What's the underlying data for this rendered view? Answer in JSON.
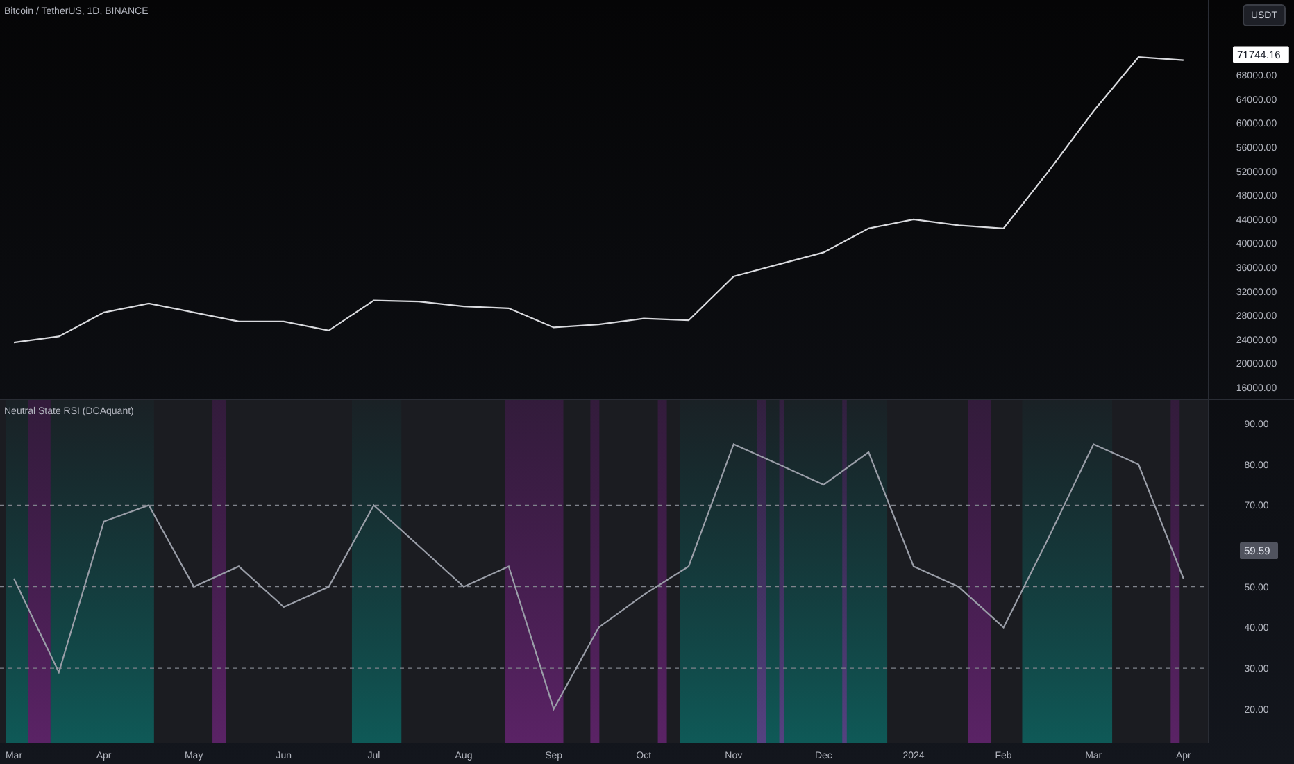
{
  "header": {
    "symbol_title": "Bitcoin / TetherUS, 1D, BINANCE",
    "currency_button": "USDT"
  },
  "price_chart": {
    "last_price_badge": "71744.16",
    "chart_data": {
      "type": "line",
      "categories": [
        null,
        null,
        null,
        null,
        null,
        null,
        null,
        null,
        null,
        null,
        null,
        null,
        null,
        null,
        null,
        null,
        null,
        null,
        null,
        null,
        null,
        null,
        null,
        null,
        null,
        null,
        null
      ],
      "series": [
        {
          "color": "#d9dade",
          "values": [
            23500,
            24500,
            28500,
            30000,
            28500,
            27000,
            27000,
            25500,
            30500,
            30300,
            29500,
            29200,
            26000,
            26500,
            27500,
            27200,
            34500,
            36500,
            38500,
            42500,
            44000,
            43000,
            42500,
            52000,
            62000,
            71000,
            70500
          ]
        }
      ],
      "ylim": [
        14150,
        80500
      ],
      "yticks": [
        {
          "value": 68000,
          "label": "68000.00"
        },
        {
          "value": 64000,
          "label": "64000.00"
        },
        {
          "value": 60000,
          "label": "60000.00"
        },
        {
          "value": 56000,
          "label": "56000.00"
        },
        {
          "value": 52000,
          "label": "52000.00"
        },
        {
          "value": 48000,
          "label": "48000.00"
        },
        {
          "value": 44000,
          "label": "44000.00"
        },
        {
          "value": 40000,
          "label": "40000.00"
        },
        {
          "value": 36000,
          "label": "36000.00"
        },
        {
          "value": 32000,
          "label": "32000.00"
        },
        {
          "value": 28000,
          "label": "28000.00"
        },
        {
          "value": 24000,
          "label": "24000.00"
        },
        {
          "value": 20000,
          "label": "20000.00"
        },
        {
          "value": 16000,
          "label": "16000.00"
        }
      ]
    }
  },
  "indicator": {
    "title": "Neutral State RSI (DCAquant)",
    "last_value_badge": "59.59",
    "chart_data": {
      "type": "line",
      "categories": [
        "Mar",
        null,
        "Apr",
        null,
        "May",
        null,
        "Jun",
        null,
        "Jul",
        null,
        "Aug",
        null,
        "Sep",
        null,
        "Oct",
        null,
        "Nov",
        null,
        "Dec",
        null,
        "2024",
        null,
        "Feb",
        null,
        "Mar",
        null,
        "Apr"
      ],
      "series": [
        {
          "color": "#9a9ea8",
          "values": [
            52,
            29,
            66,
            70,
            50,
            55,
            45,
            50,
            70,
            60,
            50,
            55,
            20,
            40,
            48,
            55,
            85,
            80,
            75,
            83,
            55,
            50,
            40,
            62,
            85,
            80,
            52
          ]
        }
      ],
      "ylim": [
        11.6,
        95.8
      ],
      "yticks": [
        {
          "value": 90,
          "label": "90.00"
        },
        {
          "value": 80,
          "label": "80.00"
        },
        {
          "value": 70,
          "label": "70.00"
        },
        {
          "value": 50,
          "label": "50.00"
        },
        {
          "value": 40,
          "label": "40.00"
        },
        {
          "value": 30,
          "label": "30.00"
        },
        {
          "value": 20,
          "label": "20.00"
        }
      ],
      "grid": true
    }
  }
}
